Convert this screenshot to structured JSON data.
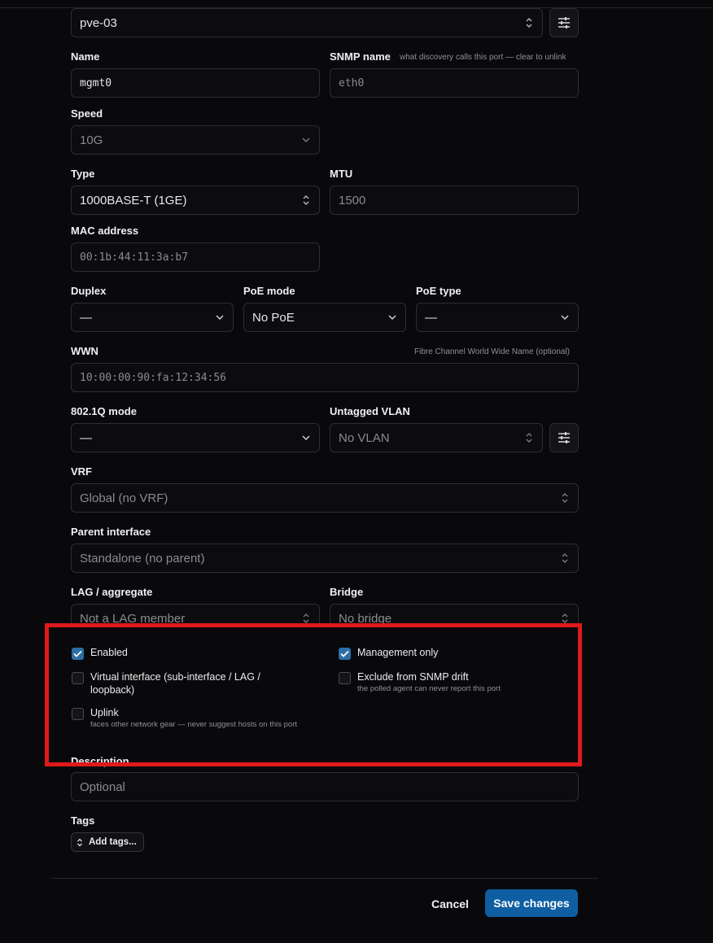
{
  "device": {
    "value": "pve-03"
  },
  "name": {
    "label": "Name",
    "value": "mgmt0"
  },
  "snmp_name": {
    "label": "SNMP name",
    "hint": "what discovery calls this port — clear to unlink",
    "placeholder": "eth0"
  },
  "speed": {
    "label": "Speed",
    "value": "10G"
  },
  "type": {
    "label": "Type",
    "value": "1000BASE-T (1GE)"
  },
  "mtu": {
    "label": "MTU",
    "placeholder": "1500"
  },
  "mac": {
    "label": "MAC address",
    "placeholder": "00:1b:44:11:3a:b7"
  },
  "duplex": {
    "label": "Duplex",
    "value": "—"
  },
  "poe_mode": {
    "label": "PoE mode",
    "value": "No PoE"
  },
  "poe_type": {
    "label": "PoE type",
    "value": "—"
  },
  "wwn": {
    "label": "WWN",
    "hint": "Fibre Channel World Wide Name (optional)",
    "placeholder": "10:00:00:90:fa:12:34:56"
  },
  "dot1q": {
    "label": "802.1Q mode",
    "value": "—"
  },
  "untagged_vlan": {
    "label": "Untagged VLAN",
    "value": "No VLAN"
  },
  "vrf": {
    "label": "VRF",
    "value": "Global (no VRF)"
  },
  "parent": {
    "label": "Parent interface",
    "value": "Standalone (no parent)"
  },
  "lag": {
    "label": "LAG / aggregate",
    "value": "Not a LAG member"
  },
  "bridge": {
    "label": "Bridge",
    "value": "No bridge"
  },
  "checkboxes": {
    "enabled": {
      "label": "Enabled",
      "checked": true
    },
    "management_only": {
      "label": "Management only",
      "checked": true
    },
    "virtual": {
      "label": "Virtual interface (sub-interface / LAG / loopback)",
      "checked": false
    },
    "exclude_snmp": {
      "label": "Exclude from SNMP drift",
      "sub": "the polled agent can never report this port",
      "checked": false
    },
    "uplink": {
      "label": "Uplink",
      "sub": "faces other network gear — never suggest hosts on this port",
      "checked": false
    }
  },
  "description": {
    "label": "Description",
    "placeholder": "Optional"
  },
  "tags": {
    "label": "Tags",
    "button": "Add tags..."
  },
  "footer": {
    "cancel": "Cancel",
    "save": "Save changes"
  },
  "colors": {
    "background": "#09090b",
    "accent": "#0e5ea1",
    "checkbox_on": "#2c6fa6",
    "highlight": "#e0191c"
  }
}
